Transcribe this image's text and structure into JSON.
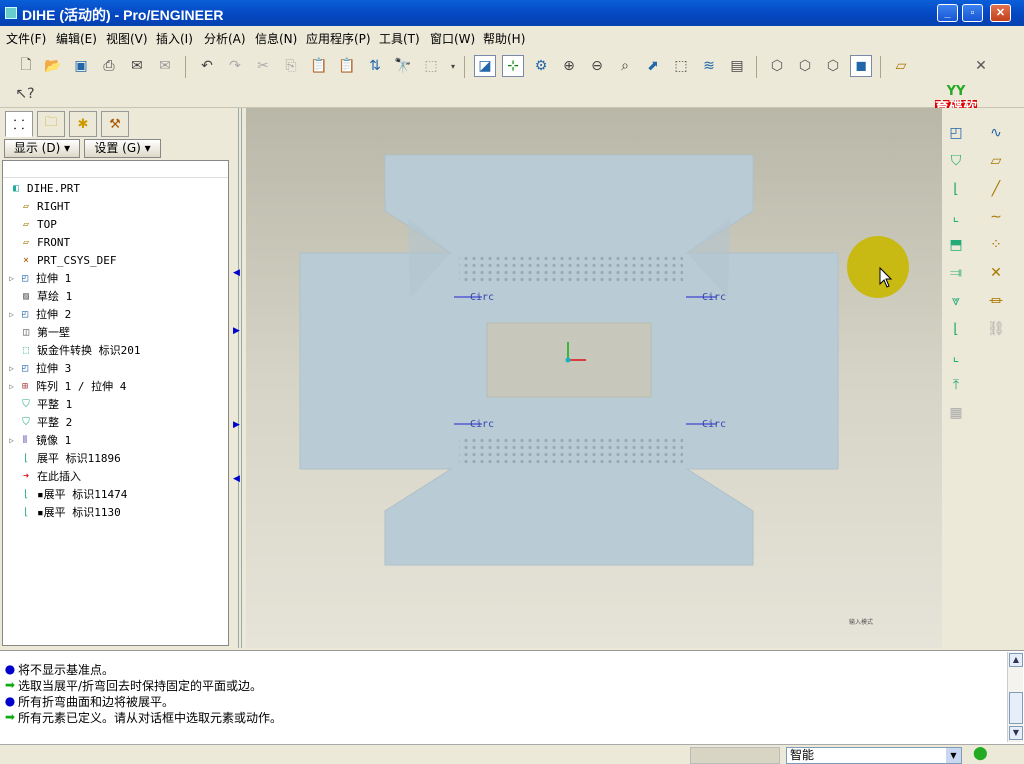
{
  "window": {
    "title": "DIHE (活动的) - Pro/ENGINEER"
  },
  "menu": [
    "文件(F)",
    "编辑(E)",
    "视图(V)",
    "插入(I)",
    "分析(A)",
    "信息(N)",
    "应用程序(P)",
    "工具(T)",
    "窗口(W)",
    "帮助(H)"
  ],
  "logo": {
    "text": "育碟软件"
  },
  "tree_controls": {
    "display": "显示 (D) ▾",
    "settings": "设置 (G) ▾"
  },
  "model_tree": [
    {
      "label": "DIHE.PRT",
      "icon": "part-icon",
      "expand": false
    },
    {
      "label": "RIGHT",
      "icon": "datum-plane-icon",
      "expand": false
    },
    {
      "label": "TOP",
      "icon": "datum-plane-icon",
      "expand": false
    },
    {
      "label": "FRONT",
      "icon": "datum-plane-icon",
      "expand": false
    },
    {
      "label": "PRT_CSYS_DEF",
      "icon": "csys-icon",
      "expand": false
    },
    {
      "label": "拉伸 1",
      "icon": "extrude-icon",
      "expand": true
    },
    {
      "label": "草绘 1",
      "icon": "sketch-icon",
      "expand": false
    },
    {
      "label": "拉伸 2",
      "icon": "extrude-icon",
      "expand": true
    },
    {
      "label": "第一壁",
      "icon": "wall-icon",
      "expand": false
    },
    {
      "label": "钣金件转换 标识201",
      "icon": "sheetmetal-convert-icon",
      "expand": false
    },
    {
      "label": "拉伸 3",
      "icon": "extrude-icon",
      "expand": true
    },
    {
      "label": "阵列 1 / 拉伸 4",
      "icon": "pattern-icon",
      "expand": true
    },
    {
      "label": "平整 1",
      "icon": "flat-wall-icon",
      "expand": false
    },
    {
      "label": "平整 2",
      "icon": "flat-wall-icon",
      "expand": false
    },
    {
      "label": "镜像 1",
      "icon": "mirror-icon",
      "expand": true
    },
    {
      "label": "展平 标识11896",
      "icon": "unbend-icon",
      "expand": false
    },
    {
      "label": "在此插入",
      "icon": "insert-here-arrow-icon",
      "expand": false
    },
    {
      "label": "▪展平 标识11474",
      "icon": "unbend-icon",
      "expand": false
    },
    {
      "label": "▪展平 标识1130",
      "icon": "unbend-icon",
      "expand": false
    }
  ],
  "viewport": {
    "labels": [
      "Circ",
      "Circ",
      "Circ",
      "Circ"
    ],
    "corner_note": "输入模式"
  },
  "messages": [
    {
      "icon": "info-bullet-icon",
      "text": "将不显示基准点。"
    },
    {
      "icon": "prompt-arrow-icon",
      "text": "选取当展平/折弯回去时保持固定的平面或边。"
    },
    {
      "icon": "info-bullet-icon",
      "text": "所有折弯曲面和边将被展平。"
    },
    {
      "icon": "prompt-arrow-icon",
      "text": "所有元素已定义。请从对话框中选取元素或动作。"
    }
  ],
  "status": {
    "filter": "智能"
  },
  "colors": {
    "part": "#b9ccd6",
    "cursor_halo": "#c8b800",
    "accent": "#0549c4"
  }
}
